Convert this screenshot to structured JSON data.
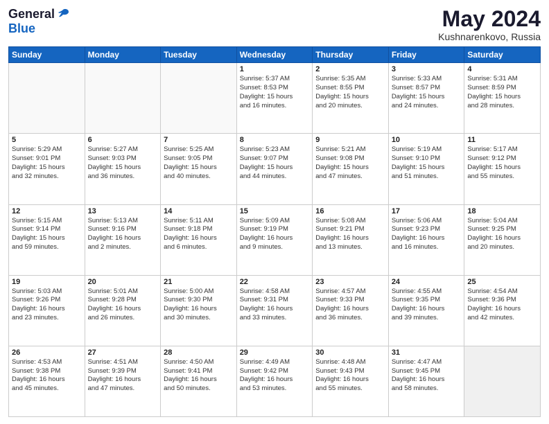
{
  "header": {
    "logo": {
      "general": "General",
      "blue": "Blue"
    },
    "title": "May 2024",
    "subtitle": "Kushnarenkovo, Russia"
  },
  "calendar": {
    "headers": [
      "Sunday",
      "Monday",
      "Tuesday",
      "Wednesday",
      "Thursday",
      "Friday",
      "Saturday"
    ],
    "weeks": [
      [
        {
          "day": "",
          "info": ""
        },
        {
          "day": "",
          "info": ""
        },
        {
          "day": "",
          "info": ""
        },
        {
          "day": "1",
          "info": "Sunrise: 5:37 AM\nSunset: 8:53 PM\nDaylight: 15 hours\nand 16 minutes."
        },
        {
          "day": "2",
          "info": "Sunrise: 5:35 AM\nSunset: 8:55 PM\nDaylight: 15 hours\nand 20 minutes."
        },
        {
          "day": "3",
          "info": "Sunrise: 5:33 AM\nSunset: 8:57 PM\nDaylight: 15 hours\nand 24 minutes."
        },
        {
          "day": "4",
          "info": "Sunrise: 5:31 AM\nSunset: 8:59 PM\nDaylight: 15 hours\nand 28 minutes."
        }
      ],
      [
        {
          "day": "5",
          "info": "Sunrise: 5:29 AM\nSunset: 9:01 PM\nDaylight: 15 hours\nand 32 minutes."
        },
        {
          "day": "6",
          "info": "Sunrise: 5:27 AM\nSunset: 9:03 PM\nDaylight: 15 hours\nand 36 minutes."
        },
        {
          "day": "7",
          "info": "Sunrise: 5:25 AM\nSunset: 9:05 PM\nDaylight: 15 hours\nand 40 minutes."
        },
        {
          "day": "8",
          "info": "Sunrise: 5:23 AM\nSunset: 9:07 PM\nDaylight: 15 hours\nand 44 minutes."
        },
        {
          "day": "9",
          "info": "Sunrise: 5:21 AM\nSunset: 9:08 PM\nDaylight: 15 hours\nand 47 minutes."
        },
        {
          "day": "10",
          "info": "Sunrise: 5:19 AM\nSunset: 9:10 PM\nDaylight: 15 hours\nand 51 minutes."
        },
        {
          "day": "11",
          "info": "Sunrise: 5:17 AM\nSunset: 9:12 PM\nDaylight: 15 hours\nand 55 minutes."
        }
      ],
      [
        {
          "day": "12",
          "info": "Sunrise: 5:15 AM\nSunset: 9:14 PM\nDaylight: 15 hours\nand 59 minutes."
        },
        {
          "day": "13",
          "info": "Sunrise: 5:13 AM\nSunset: 9:16 PM\nDaylight: 16 hours\nand 2 minutes."
        },
        {
          "day": "14",
          "info": "Sunrise: 5:11 AM\nSunset: 9:18 PM\nDaylight: 16 hours\nand 6 minutes."
        },
        {
          "day": "15",
          "info": "Sunrise: 5:09 AM\nSunset: 9:19 PM\nDaylight: 16 hours\nand 9 minutes."
        },
        {
          "day": "16",
          "info": "Sunrise: 5:08 AM\nSunset: 9:21 PM\nDaylight: 16 hours\nand 13 minutes."
        },
        {
          "day": "17",
          "info": "Sunrise: 5:06 AM\nSunset: 9:23 PM\nDaylight: 16 hours\nand 16 minutes."
        },
        {
          "day": "18",
          "info": "Sunrise: 5:04 AM\nSunset: 9:25 PM\nDaylight: 16 hours\nand 20 minutes."
        }
      ],
      [
        {
          "day": "19",
          "info": "Sunrise: 5:03 AM\nSunset: 9:26 PM\nDaylight: 16 hours\nand 23 minutes."
        },
        {
          "day": "20",
          "info": "Sunrise: 5:01 AM\nSunset: 9:28 PM\nDaylight: 16 hours\nand 26 minutes."
        },
        {
          "day": "21",
          "info": "Sunrise: 5:00 AM\nSunset: 9:30 PM\nDaylight: 16 hours\nand 30 minutes."
        },
        {
          "day": "22",
          "info": "Sunrise: 4:58 AM\nSunset: 9:31 PM\nDaylight: 16 hours\nand 33 minutes."
        },
        {
          "day": "23",
          "info": "Sunrise: 4:57 AM\nSunset: 9:33 PM\nDaylight: 16 hours\nand 36 minutes."
        },
        {
          "day": "24",
          "info": "Sunrise: 4:55 AM\nSunset: 9:35 PM\nDaylight: 16 hours\nand 39 minutes."
        },
        {
          "day": "25",
          "info": "Sunrise: 4:54 AM\nSunset: 9:36 PM\nDaylight: 16 hours\nand 42 minutes."
        }
      ],
      [
        {
          "day": "26",
          "info": "Sunrise: 4:53 AM\nSunset: 9:38 PM\nDaylight: 16 hours\nand 45 minutes."
        },
        {
          "day": "27",
          "info": "Sunrise: 4:51 AM\nSunset: 9:39 PM\nDaylight: 16 hours\nand 47 minutes."
        },
        {
          "day": "28",
          "info": "Sunrise: 4:50 AM\nSunset: 9:41 PM\nDaylight: 16 hours\nand 50 minutes."
        },
        {
          "day": "29",
          "info": "Sunrise: 4:49 AM\nSunset: 9:42 PM\nDaylight: 16 hours\nand 53 minutes."
        },
        {
          "day": "30",
          "info": "Sunrise: 4:48 AM\nSunset: 9:43 PM\nDaylight: 16 hours\nand 55 minutes."
        },
        {
          "day": "31",
          "info": "Sunrise: 4:47 AM\nSunset: 9:45 PM\nDaylight: 16 hours\nand 58 minutes."
        },
        {
          "day": "",
          "info": ""
        }
      ]
    ]
  }
}
